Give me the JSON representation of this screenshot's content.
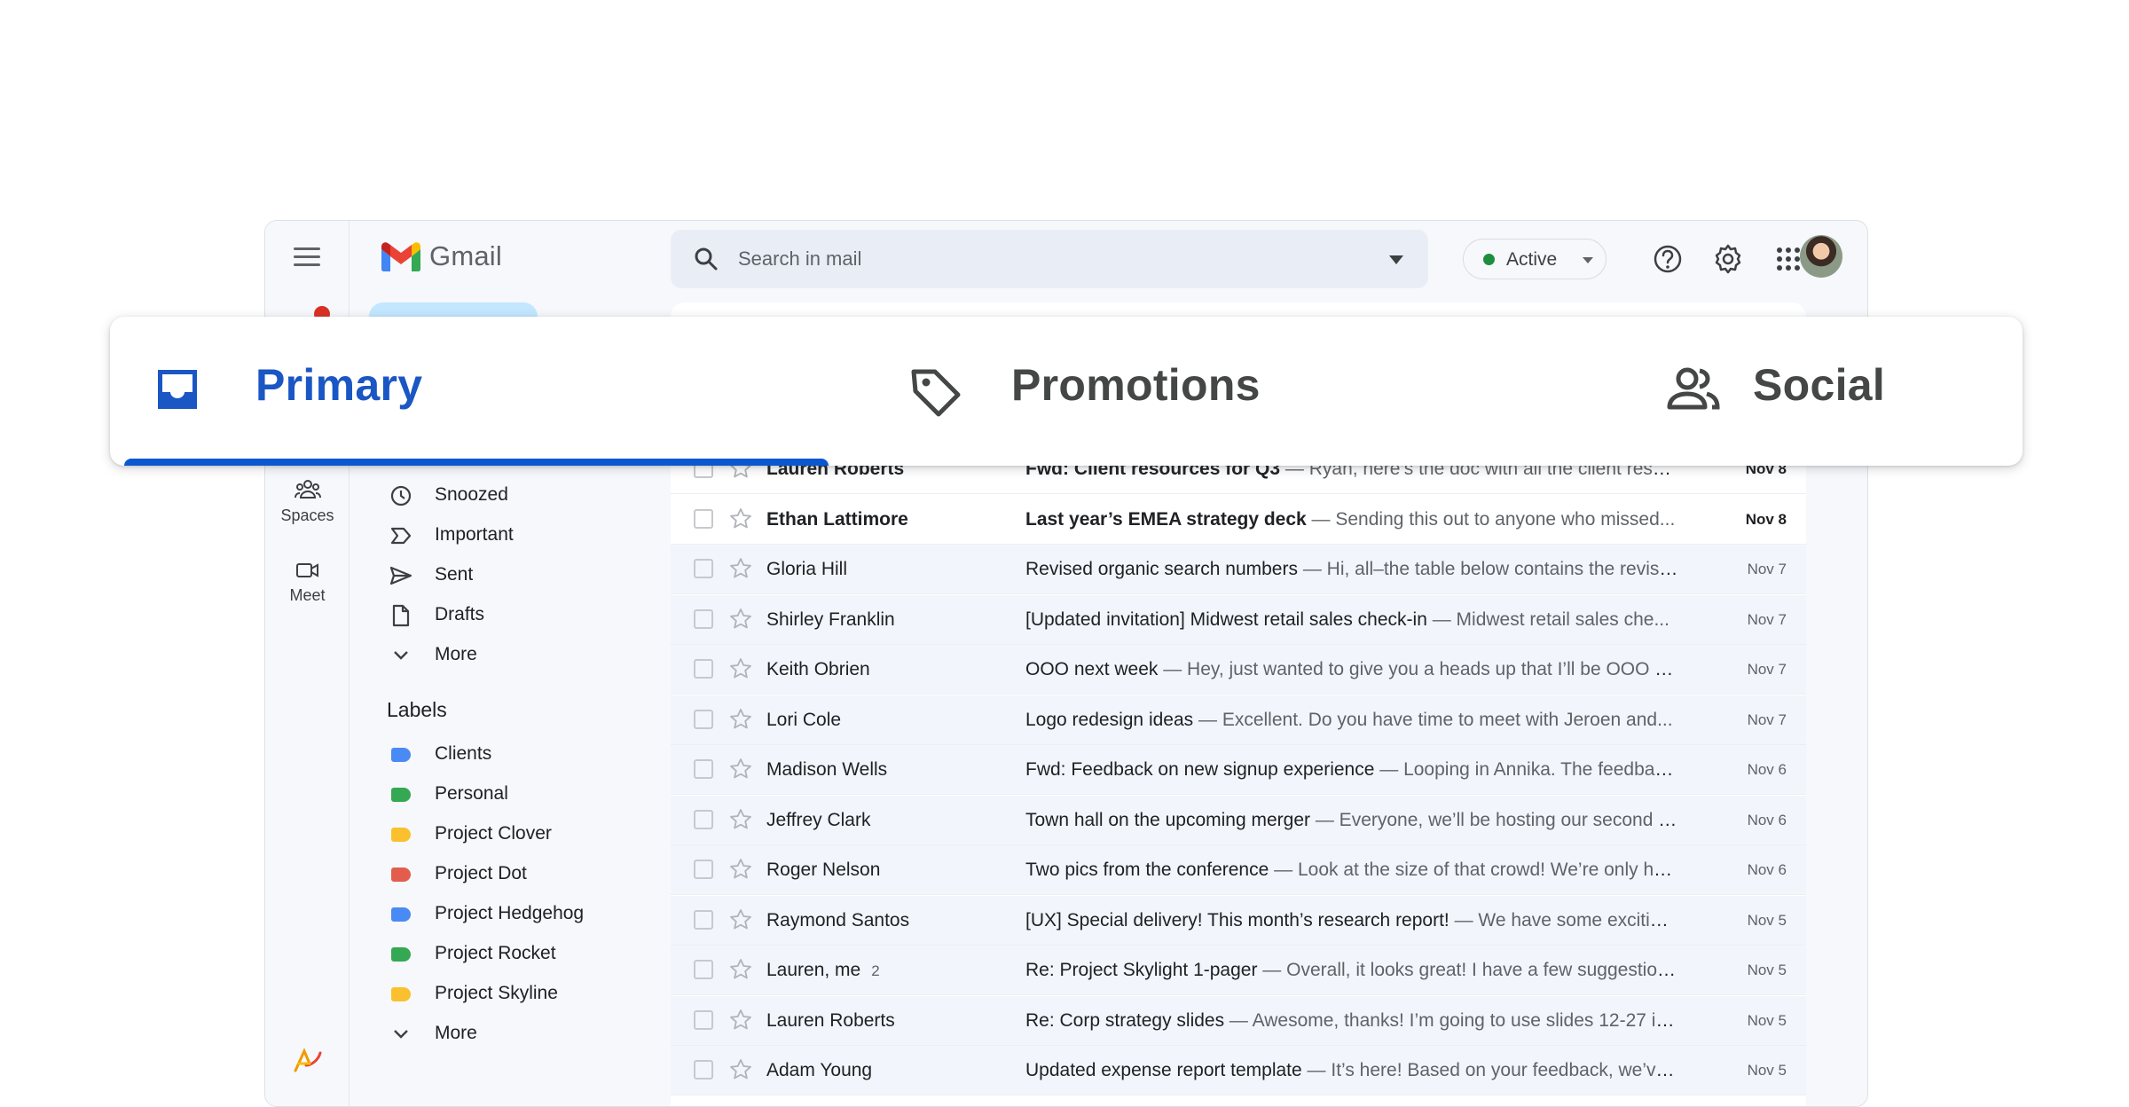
{
  "app": {
    "title": "Gmail"
  },
  "search": {
    "placeholder": "Search in mail"
  },
  "status": {
    "label": "Active",
    "color": "#1e8e3e"
  },
  "rail": {
    "items": [
      {
        "label": "Spaces",
        "icon": "spaces-icon"
      },
      {
        "label": "Meet",
        "icon": "meet-icon"
      }
    ]
  },
  "nav": {
    "items": [
      {
        "label": "Snoozed",
        "icon": "clock-icon"
      },
      {
        "label": "Important",
        "icon": "important-icon"
      },
      {
        "label": "Sent",
        "icon": "send-icon"
      },
      {
        "label": "Drafts",
        "icon": "draft-icon"
      },
      {
        "label": "More",
        "icon": "chevron-down-icon"
      }
    ]
  },
  "labels": {
    "heading": "Labels",
    "items": [
      {
        "label": "Clients",
        "color": "#4a8af4"
      },
      {
        "label": "Personal",
        "color": "#34a853"
      },
      {
        "label": "Project Clover",
        "color": "#fbc02d"
      },
      {
        "label": "Project Dot",
        "color": "#e35d4f"
      },
      {
        "label": "Project Hedgehog",
        "color": "#4a8af4"
      },
      {
        "label": "Project Rocket",
        "color": "#34a853"
      },
      {
        "label": "Project Skyline",
        "color": "#fbc02d"
      }
    ],
    "more": "More"
  },
  "tabs": [
    {
      "label": "Primary",
      "icon": "inbox-icon",
      "active": true
    },
    {
      "label": "Promotions",
      "icon": "tag-icon",
      "active": false
    },
    {
      "label": "Social",
      "icon": "people-icon",
      "active": false
    }
  ],
  "emails": [
    {
      "sender": "Lauren Roberts",
      "count": "",
      "subject": "Fwd: Client resources for Q3",
      "snippet": " — Ryan, here’s the doc with all the client resou...",
      "date": "Nov 8",
      "unread": true
    },
    {
      "sender": "Ethan Lattimore",
      "count": "",
      "subject": "Last year’s EMEA strategy deck",
      "snippet": " — Sending this out to anyone who missed...",
      "date": "Nov 8",
      "unread": true
    },
    {
      "sender": "Gloria Hill",
      "count": "",
      "subject": "Revised organic search numbers",
      "snippet": " — Hi, all–the table below contains the revise...",
      "date": "Nov 7",
      "unread": false
    },
    {
      "sender": "Shirley Franklin",
      "count": "",
      "subject": "[Updated invitation] Midwest retail sales check-in",
      "snippet": " — Midwest retail sales che...",
      "date": "Nov 7",
      "unread": false
    },
    {
      "sender": "Keith Obrien",
      "count": "",
      "subject": "OOO next week",
      "snippet": " — Hey, just wanted to give you a heads up that I’ll be OOO ne...",
      "date": "Nov 7",
      "unread": false
    },
    {
      "sender": "Lori Cole",
      "count": "",
      "subject": "Logo redesign ideas",
      "snippet": " — Excellent. Do you have time to meet with Jeroen and...",
      "date": "Nov 7",
      "unread": false
    },
    {
      "sender": "Madison Wells",
      "count": "",
      "subject": "Fwd: Feedback on new signup experience",
      "snippet": " — Looping in Annika. The feedback...",
      "date": "Nov 6",
      "unread": false
    },
    {
      "sender": "Jeffrey Clark",
      "count": "",
      "subject": "Town hall on the upcoming merger",
      "snippet": " — Everyone, we’ll be hosting our second t...",
      "date": "Nov 6",
      "unread": false
    },
    {
      "sender": "Roger Nelson",
      "count": "",
      "subject": "Two pics from the conference",
      "snippet": " — Look at the size of that crowd! We’re only ha...",
      "date": "Nov 6",
      "unread": false
    },
    {
      "sender": "Raymond Santos",
      "count": "",
      "subject": "[UX] Special delivery! This month’s research report!",
      "snippet": " — We have some exciting...",
      "date": "Nov 5",
      "unread": false
    },
    {
      "sender": "Lauren, me",
      "count": "2",
      "subject": "Re: Project Skylight 1-pager",
      "snippet": " — Overall, it looks great! I have a few suggestions...",
      "date": "Nov 5",
      "unread": false
    },
    {
      "sender": "Lauren Roberts",
      "count": "",
      "subject": "Re: Corp strategy slides",
      "snippet": " — Awesome, thanks! I’m going to use slides 12-27 in...",
      "date": "Nov 5",
      "unread": false
    },
    {
      "sender": "Adam Young",
      "count": "",
      "subject": "Updated expense report template",
      "snippet": " — It’s here! Based on your feedback, we’ve...",
      "date": "Nov 5",
      "unread": false
    }
  ],
  "colors": {
    "accent": "#0b57d0",
    "primary_tab": "#1a56c4",
    "background": "#f6f8fc"
  }
}
